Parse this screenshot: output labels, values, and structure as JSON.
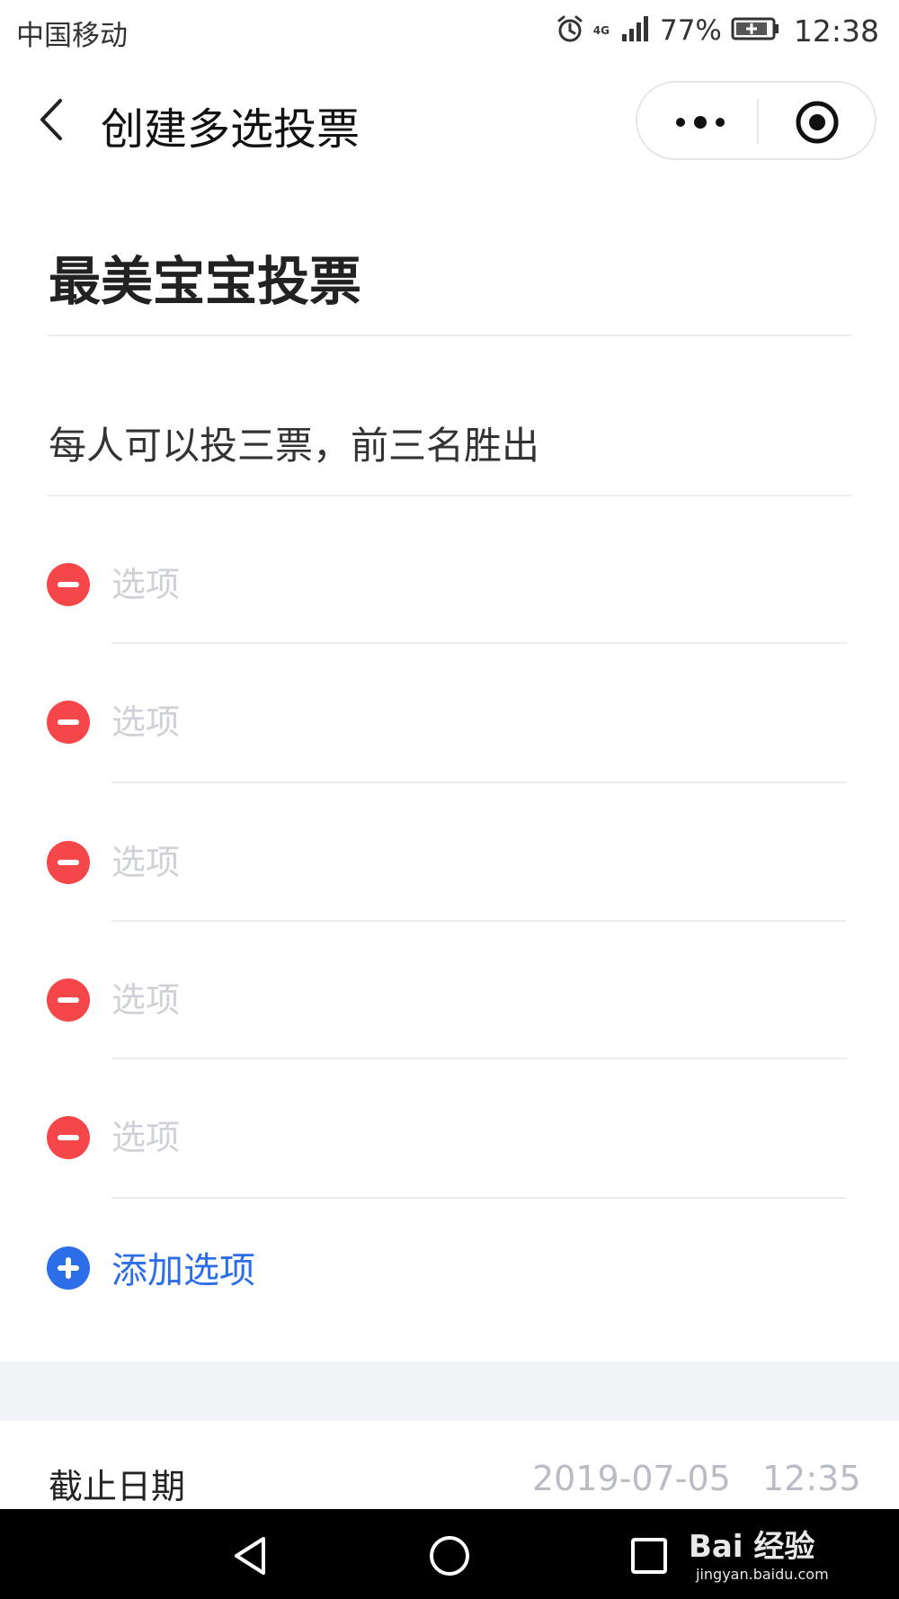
{
  "status_bar": {
    "carrier": "中国移动",
    "network": "4G",
    "battery_percent": "77%",
    "time": "12:38"
  },
  "nav": {
    "title": "创建多选投票"
  },
  "vote": {
    "title": "最美宝宝投票",
    "description": "每人可以投三票，前三名胜出",
    "options": [
      {
        "placeholder": "选项",
        "value": ""
      },
      {
        "placeholder": "选项",
        "value": ""
      },
      {
        "placeholder": "选项",
        "value": ""
      },
      {
        "placeholder": "选项",
        "value": ""
      },
      {
        "placeholder": "选项",
        "value": ""
      }
    ],
    "add_option_label": "添加选项"
  },
  "deadline": {
    "label": "截止日期",
    "date": "2019-07-05",
    "time": "12:35"
  },
  "watermark": {
    "brand": "Bai 经验",
    "url": "jingyan.baidu.com"
  },
  "icons": {
    "alarm": "alarm-icon",
    "signal": "signal-icon",
    "battery": "battery-icon",
    "back": "back-chevron-icon",
    "more": "more-dots-icon",
    "close": "target-close-icon",
    "remove": "minus-circle-icon",
    "add": "plus-circle-icon"
  },
  "colors": {
    "remove_red": "#f5474a",
    "add_blue": "#2c6de8",
    "placeholder_gray": "#cfd1d8",
    "band_gray": "#f2f3f7"
  }
}
